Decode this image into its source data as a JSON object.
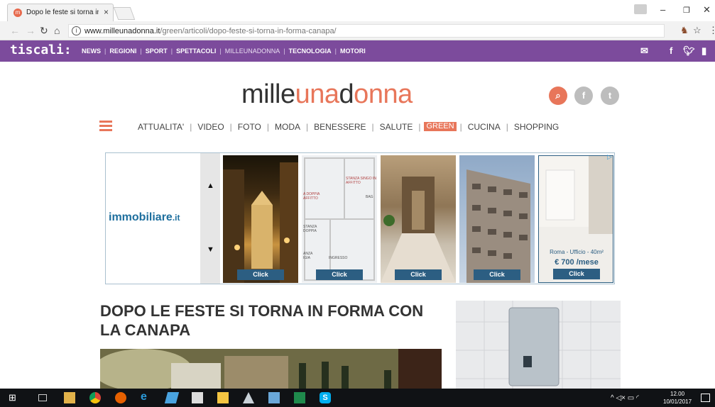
{
  "browser": {
    "tab_title": "Dopo le feste si torna in",
    "url": "www.milleunadonna.it",
    "url_path": "/green/articoli/dopo-feste-si-torna-in-forma-canapa/"
  },
  "tiscali": {
    "logo": "tiscali:",
    "nav": [
      "NEWS",
      "REGIONI",
      "SPORT",
      "SPETTACOLI",
      "MILLEUNADONNA",
      "TECNOLOGIA",
      "MOTORI"
    ]
  },
  "site": {
    "logo_a": "mille",
    "logo_b": "una",
    "logo_c": "d",
    "logo_d": "o",
    "logo_e": "nna",
    "nav": [
      "ATTUALITA'",
      "VIDEO",
      "FOTO",
      "MODA",
      "BENESSERE",
      "SALUTE",
      "GREEN",
      "CUCINA",
      "SHOPPING"
    ]
  },
  "ad": {
    "logo_a": "i",
    "logo_b": "mmobiliare",
    "logo_c": ".it",
    "click": "Click",
    "plan_labels": [
      "STANZA SINGO IN AFFITTO",
      "BAG",
      "A DOPPIA AFFITTO",
      "STANZA DOPPIA",
      "INGRESSO",
      "ANZA IGIA"
    ],
    "place": "Roma - Ufficio - 40m²",
    "price": "€ 700 /mese"
  },
  "article": {
    "headline": "DOPO LE FESTE SI TORNA IN FORMA CON LA CANAPA"
  },
  "taskbar": {
    "time": "12.00",
    "date": "10/01/2017"
  },
  "colors": {
    "tiscali_purple": "#7c4b9c",
    "brand_orange": "#e8765a",
    "ad_blue": "#2c5e82"
  }
}
